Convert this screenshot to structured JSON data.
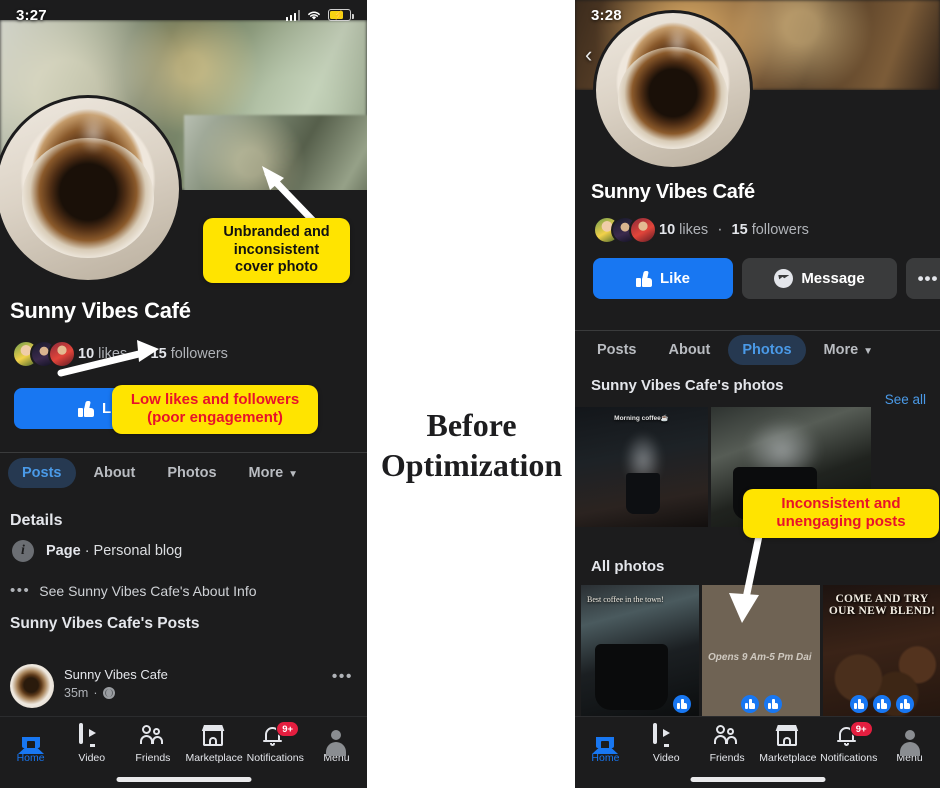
{
  "center": {
    "line1": "Before",
    "line2": "Optimization"
  },
  "annotations": [
    {
      "id": "cover-callout",
      "text": "Unbranded and inconsistent cover photo",
      "bg": "#ffe400",
      "color": "#121212"
    },
    {
      "id": "engagement-callout",
      "text": "Low likes and followers (poor engagement)",
      "bg": "#ffe400",
      "color": "#e8122a"
    },
    {
      "id": "posts-callout",
      "text": "Inconsistent and unengaging posts",
      "bg": "#ffe400",
      "color": "#e8122a"
    }
  ],
  "left_phone": {
    "status": {
      "time": "3:27",
      "signal_icon": "cellular-signal-icon",
      "wifi_icon": "wifi-icon",
      "battery_icon": "battery-charging-icon"
    },
    "profile": {
      "name": "Sunny Vibes Café",
      "likes_count": "10",
      "likes_label": "likes",
      "separator": "·",
      "followers_count": "15",
      "followers_label": "followers"
    },
    "actions": {
      "like": "Like",
      "more": "•••"
    },
    "tabs": [
      {
        "label": "Posts",
        "active": true
      },
      {
        "label": "About",
        "active": false
      },
      {
        "label": "Photos",
        "active": false
      },
      {
        "label": "More",
        "active": false
      }
    ],
    "details": {
      "heading": "Details",
      "category_bold": "Page",
      "category_rest": " · Personal blog",
      "about_link": "See Sunny Vibes Cafe's About Info",
      "posts_heading": "Sunny Vibes Cafe's  Posts"
    },
    "post": {
      "author": "Sunny Vibes Cafe",
      "time": "35m",
      "dot": "·",
      "menu": "•••"
    },
    "nav": [
      {
        "label": "Home",
        "icon": "home-icon",
        "active": true,
        "badge": ""
      },
      {
        "label": "Video",
        "icon": "video-icon",
        "active": false,
        "badge": ""
      },
      {
        "label": "Friends",
        "icon": "friends-icon",
        "active": false,
        "badge": ""
      },
      {
        "label": "Marketplace",
        "icon": "marketplace-icon",
        "active": false,
        "badge": ""
      },
      {
        "label": "Notifications",
        "icon": "bell-icon",
        "active": false,
        "badge": "9+"
      },
      {
        "label": "Menu",
        "icon": "menu-avatar-icon",
        "active": false,
        "badge": ""
      }
    ]
  },
  "right_phone": {
    "status": {
      "time": "3:28"
    },
    "back_icon": "back-chevron-icon",
    "profile": {
      "name": "Sunny Vibes Café",
      "likes_count": "10",
      "likes_label": "likes",
      "separator": "·",
      "followers_count": "15",
      "followers_label": "followers"
    },
    "actions": {
      "like": "Like",
      "message": "Message",
      "more": "•••"
    },
    "tabs": [
      {
        "label": "Posts",
        "active": false
      },
      {
        "label": "About",
        "active": false
      },
      {
        "label": "Photos",
        "active": true
      },
      {
        "label": "More",
        "active": false
      }
    ],
    "photos": {
      "heading": "Sunny Vibes Cafe's photos",
      "see_all": "See all",
      "row1": [
        {
          "caption": "Morning coffee☕"
        },
        {
          "caption": ""
        }
      ],
      "all_heading": "All photos",
      "row2": [
        {
          "caption": "Best coffee in the town!",
          "reactions": 1
        },
        {
          "caption": "Opens 9 Am-5 Pm Dai",
          "reactions": 2
        },
        {
          "caption": "COME AND TRY OUR NEW BLEND!",
          "reactions": 3
        }
      ]
    },
    "nav": [
      {
        "label": "Home",
        "icon": "home-icon",
        "active": true,
        "badge": ""
      },
      {
        "label": "Video",
        "icon": "video-icon",
        "active": false,
        "badge": ""
      },
      {
        "label": "Friends",
        "icon": "friends-icon",
        "active": false,
        "badge": ""
      },
      {
        "label": "Marketplace",
        "icon": "marketplace-icon",
        "active": false,
        "badge": ""
      },
      {
        "label": "Notifications",
        "icon": "bell-icon",
        "active": false,
        "badge": "9+"
      },
      {
        "label": "Menu",
        "icon": "menu-avatar-icon",
        "active": false,
        "badge": ""
      }
    ]
  },
  "colors": {
    "accent": "#1877f2",
    "link": "#4a9ae8",
    "highlight": "#ffe400",
    "alert": "#e8122a",
    "surface": "#1c1c1d"
  }
}
